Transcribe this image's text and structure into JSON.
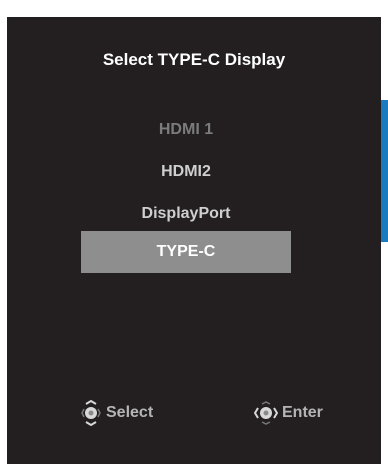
{
  "osd": {
    "title": "Select TYPE-C Display",
    "options": [
      {
        "label": "HDMI 1",
        "state": "disabled"
      },
      {
        "label": "HDMI2",
        "state": "normal"
      },
      {
        "label": "DisplayPort",
        "state": "normal"
      },
      {
        "label": "TYPE-C",
        "state": "selected"
      }
    ],
    "hints": {
      "select_label": "Select",
      "select_icon": "joystick-up-down-icon",
      "enter_label": "Enter",
      "enter_icon": "joystick-left-right-icon"
    }
  },
  "colors": {
    "panel": "#231f20",
    "selected_bg": "#8e8e8e",
    "scrollbar": "#1a7bc1",
    "text": "#ffffff",
    "muted": "#7c7c7c"
  }
}
